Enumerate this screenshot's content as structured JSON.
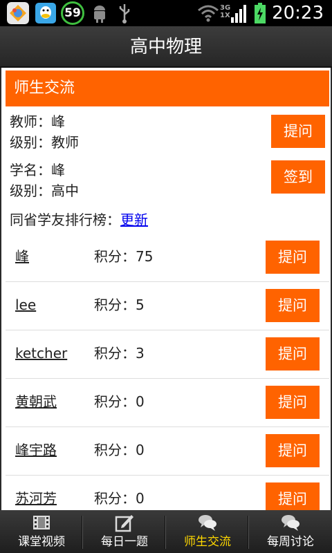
{
  "status_bar": {
    "badge": "59",
    "network": [
      "3G",
      "1X"
    ],
    "time": "20:23"
  },
  "header": {
    "title": "高中物理"
  },
  "section": {
    "title": "师生交流"
  },
  "teacher": {
    "name_line": "教师：峰",
    "level_line": "级别：教师",
    "ask_label": "提问"
  },
  "student": {
    "name_line": "学名：峰",
    "level_line": "级别：高中",
    "checkin_label": "签到"
  },
  "ranking": {
    "label": "同省学友排行榜：",
    "refresh": "更新"
  },
  "rank_rows": [
    {
      "name": "峰",
      "score": "积分：75",
      "ask": "提问"
    },
    {
      "name": "lee",
      "score": "积分：5",
      "ask": "提问"
    },
    {
      "name": "ketcher",
      "score": "积分：3",
      "ask": "提问"
    },
    {
      "name": "黄朝武",
      "score": "积分：0",
      "ask": "提问"
    },
    {
      "name": "峰宇路",
      "score": "积分：0",
      "ask": "提问"
    },
    {
      "name": "苏河芳",
      "score": "积分：0",
      "ask": "提问"
    }
  ],
  "tabs": [
    {
      "label": "课堂视频",
      "icon": "film-icon"
    },
    {
      "label": "每日一题",
      "icon": "edit-icon"
    },
    {
      "label": "师生交流",
      "icon": "chat-bubbles-icon"
    },
    {
      "label": "每周讨论",
      "icon": "chat-bubbles-icon"
    }
  ],
  "colors": {
    "accent": "#ff6300",
    "active_tab": "#ffd800"
  }
}
